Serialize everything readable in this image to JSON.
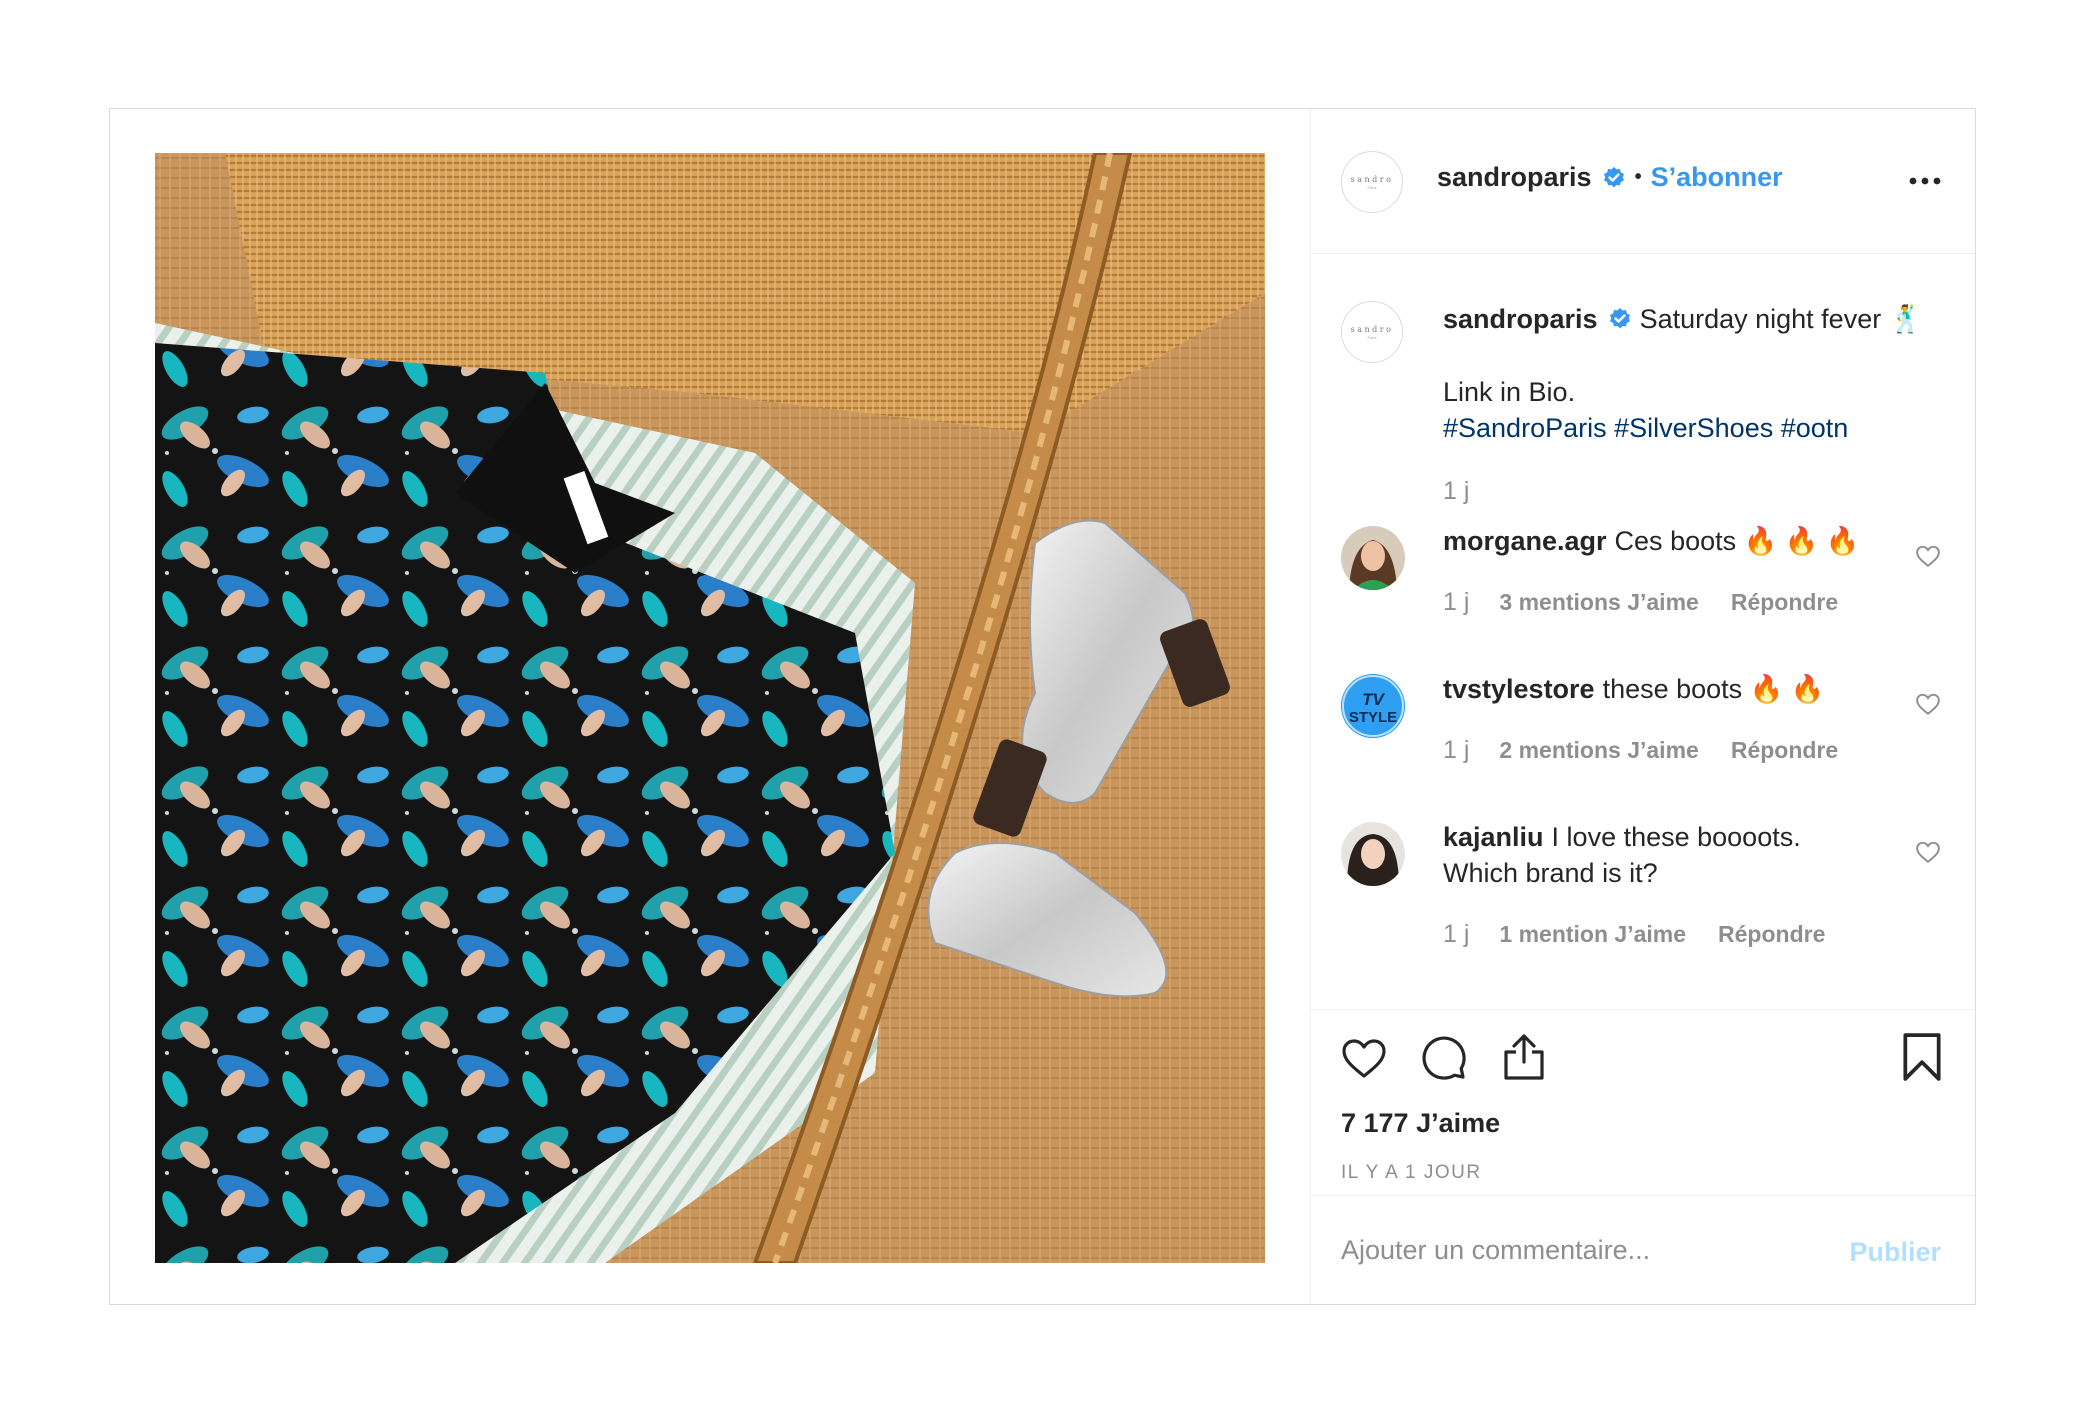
{
  "post": {
    "username": "sandroparis",
    "follow_label": "S’abonner",
    "separator": "•",
    "avatar_wordmark": "sandro",
    "avatar_subtext": "Paris",
    "caption": {
      "text": "Saturday night fever",
      "emoji": "🕺",
      "link_line": "Link in Bio.",
      "hashtags": [
        "#SandroParis",
        "#SilverShoes",
        "#ootn"
      ],
      "age": "1 j"
    },
    "comments": [
      {
        "username": "morgane.agr",
        "text": "Ces boots 🔥 🔥 🔥",
        "age": "1 j",
        "likes_label": "3 mentions J’aime",
        "reply_label": "Répondre"
      },
      {
        "username": "tvstylestore",
        "text": "these boots 🔥 🔥",
        "age": "1 j",
        "likes_label": "2 mentions J’aime",
        "reply_label": "Répondre",
        "avatar_text": [
          "TV",
          "STYLE"
        ]
      },
      {
        "username": "kajanliu",
        "text": "I love these boooots.",
        "text_line2": "Which brand is it?",
        "age": "1 j",
        "likes_label": "1 mention J’aime",
        "reply_label": "Répondre"
      }
    ],
    "likes_count": "7 177 J’aime",
    "date_label": "IL Y A 1 JOUR",
    "add_comment_placeholder": "Ajouter un commentaire...",
    "publish_label": "Publier"
  },
  "colors": {
    "link_blue": "#3897f0",
    "hashtag_navy": "#003569",
    "muted_gray": "#8e8e8e",
    "publish_disabled": "#b2dffc",
    "verified_blue": "#3897f0"
  },
  "icons": [
    "verified-icon",
    "more-options-icon",
    "heart-icon",
    "comment-icon",
    "share-icon",
    "bookmark-icon"
  ]
}
